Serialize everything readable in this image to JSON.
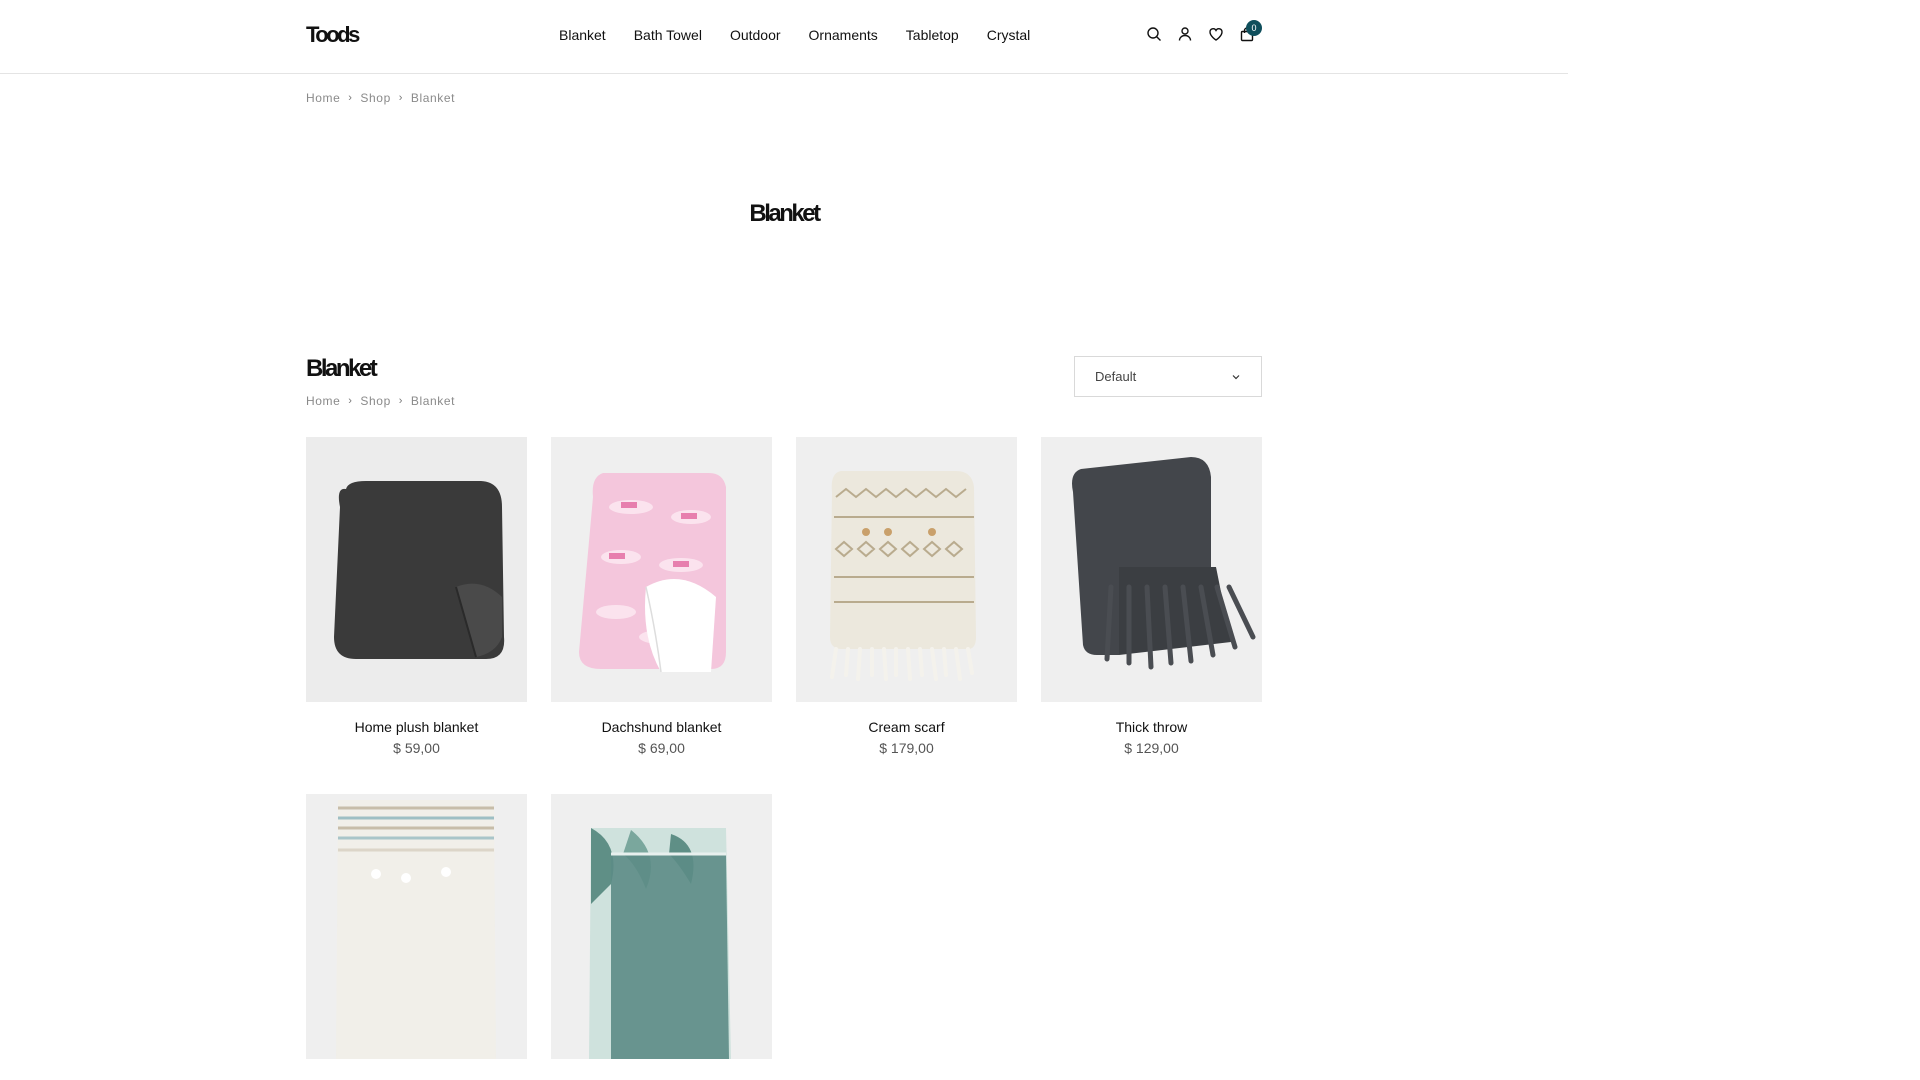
{
  "header": {
    "logo": "Toods",
    "nav": [
      "Blanket",
      "Bath Towel",
      "Outdoor",
      "Ornaments",
      "Tabletop",
      "Crystal"
    ],
    "icons": [
      "search-icon",
      "user-icon",
      "heart-icon",
      "bag-icon"
    ],
    "cart_count": "0",
    "badge_color": "#0f4f5c"
  },
  "breadcrumb": [
    {
      "label": "Home"
    },
    {
      "label": "Shop"
    },
    {
      "label": "Blanket"
    }
  ],
  "hero": {
    "title": "Blanket"
  },
  "section": {
    "title": "Blanket"
  },
  "sort": {
    "selected": "Default"
  },
  "products": [
    {
      "name": "Home plush blanket",
      "price": "$ 59,00"
    },
    {
      "name": "Dachshund blanket",
      "price": "$ 69,00"
    },
    {
      "name": "Cream scarf",
      "price": "$ 179,00"
    },
    {
      "name": "Thick throw",
      "price": "$ 129,00"
    },
    {
      "name": "",
      "price": ""
    },
    {
      "name": "",
      "price": ""
    }
  ]
}
